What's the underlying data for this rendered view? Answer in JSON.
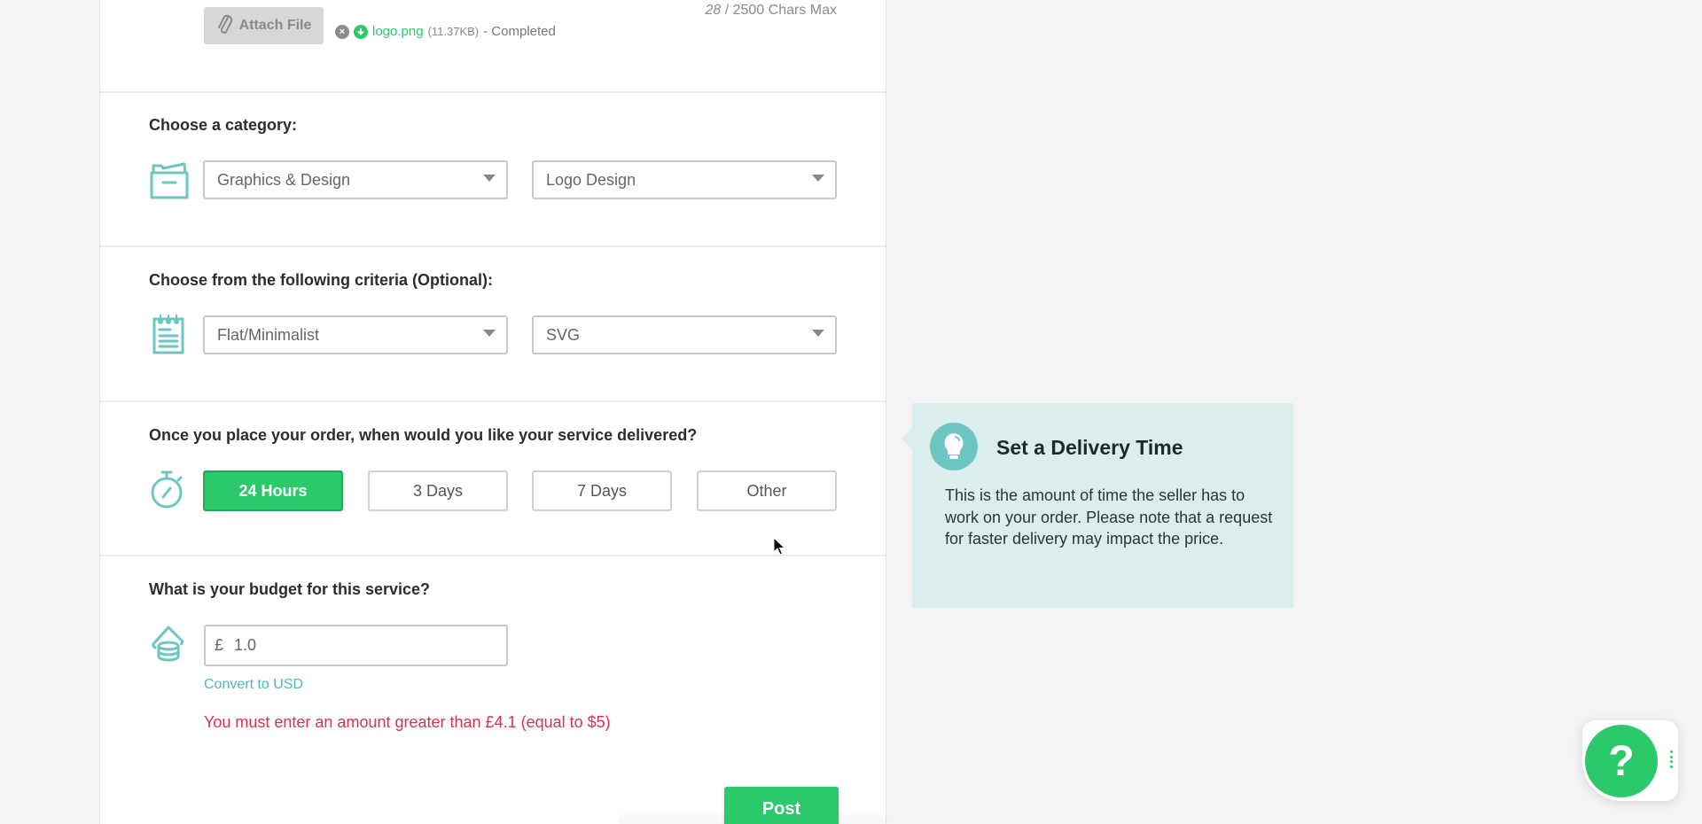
{
  "attachment": {
    "attach_label": "Attach File",
    "file_name": "logo.png",
    "file_size": "(11.37KB)",
    "status": "- Completed",
    "remove_icon": "x-circle-icon",
    "download_icon": "arrow-down-circle-icon"
  },
  "char_count": {
    "current": "28",
    "limit_text": "/ 2500 Chars Max"
  },
  "category": {
    "label": "Choose a category:",
    "icon": "folder-icon",
    "primary": "Graphics & Design",
    "secondary": "Logo Design"
  },
  "criteria": {
    "label": "Choose from the following criteria (Optional):",
    "icon": "notepad-icon",
    "style": "Flat/Minimalist",
    "format": "SVG"
  },
  "delivery": {
    "label": "Once you place your order, when would you like your service delivered?",
    "icon": "stopwatch-icon",
    "options": [
      {
        "label": "24 Hours",
        "selected": true
      },
      {
        "label": "3 Days",
        "selected": false
      },
      {
        "label": "7 Days",
        "selected": false
      },
      {
        "label": "Other",
        "selected": false
      }
    ]
  },
  "budget": {
    "label": "What is your budget for this service?",
    "icon": "coins-icon",
    "currency": "£",
    "value": "1.0",
    "convert_link": "Convert to USD",
    "error": "You must enter an amount greater than £4.1 (equal to $5)"
  },
  "actions": {
    "post_label": "Post"
  },
  "tooltip": {
    "icon": "lightbulb-icon",
    "title": "Set a Delivery Time",
    "body": "This is the amount of time the seller has to work on your order. Please note that a request for faster delivery may impact the price."
  },
  "help": {
    "label": "?",
    "menu_icon": "vertical-dots-icon"
  },
  "colors": {
    "accent_green": "#2bc96a",
    "teal_icon": "#6ec6c2",
    "error_red": "#d6334f",
    "tooltip_bg": "#d9eeed",
    "page_bg": "#f4f4f4"
  }
}
